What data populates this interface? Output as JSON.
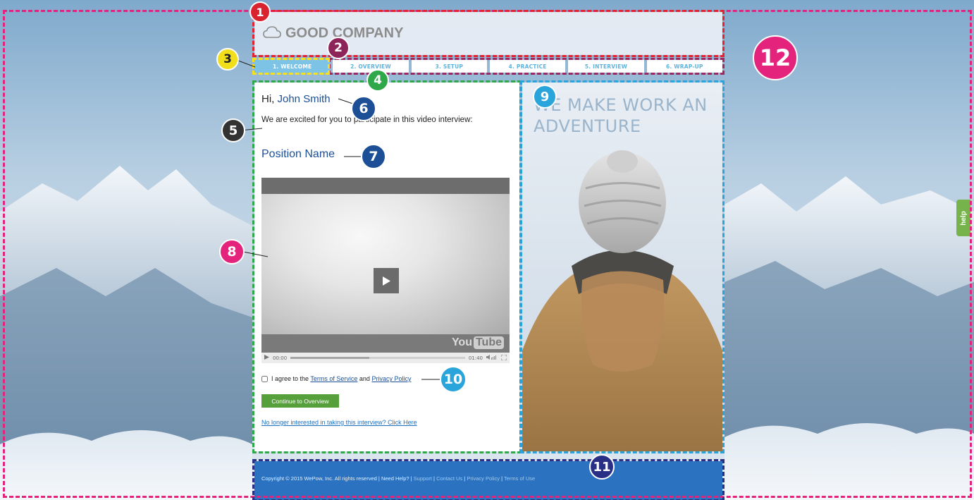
{
  "header": {
    "company_name": "GOOD COMPANY",
    "logo_icon": "cloud-icon"
  },
  "tabs": [
    {
      "label": "1. WELCOME",
      "active": true
    },
    {
      "label": "2. OVERVIEW",
      "active": false
    },
    {
      "label": "3. SETUP",
      "active": false
    },
    {
      "label": "4. PRACTICE",
      "active": false
    },
    {
      "label": "5. INTERVIEW",
      "active": false
    },
    {
      "label": "6. WRAP-UP",
      "active": false
    }
  ],
  "welcome": {
    "greeting_prefix": "Hi, ",
    "candidate_name": "John Smith",
    "intro": "We are excited for you to participate in this video interview:",
    "position_name": "Position Name"
  },
  "video": {
    "current_time": "00:00",
    "duration": "01:40",
    "progress": 0.0,
    "buffered": 0.45,
    "logo_you": "You",
    "logo_tube": "Tube"
  },
  "agreement": {
    "prefix": "I agree to the ",
    "terms_link": "Terms of Service",
    "conjunction": " and ",
    "privacy_link": "Privacy Policy"
  },
  "actions": {
    "continue_label": "Continue to Overview",
    "decline_label": "No longer interested in taking this interview? Click Here"
  },
  "promo": {
    "tagline": "WE MAKE WORK AN ADVENTURE"
  },
  "footer": {
    "copyright": "Copyright © 2015 WePow, Inc. All rights reserved",
    "need_help": "Need Help?",
    "support": "Support",
    "contact": "Contact Us",
    "privacy": "Privacy Policy",
    "terms": "Terms of Use",
    "separator": " | "
  },
  "help_tab": {
    "label": "help"
  },
  "badges": [
    "1",
    "2",
    "3",
    "4",
    "5",
    "6",
    "7",
    "8",
    "9",
    "10",
    "11",
    "12"
  ],
  "colors": {
    "accent_blue": "#1c4f96",
    "active_tab": "#7cc3e6",
    "continue_green": "#56a03c",
    "footer_blue": "#2b73c1"
  }
}
